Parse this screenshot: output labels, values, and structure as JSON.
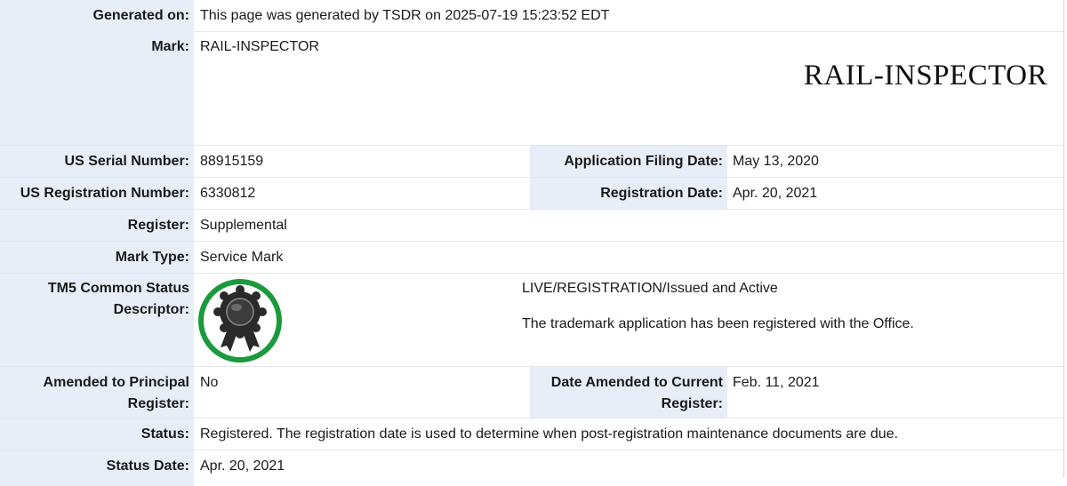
{
  "generated": {
    "label": "Generated on:",
    "value": "This page was generated by TSDR on 2025-07-19 15:23:52 EDT"
  },
  "mark": {
    "label": "Mark:",
    "value": "RAIL-INSPECTOR",
    "image_text": "RAIL-INSPECTOR"
  },
  "serial": {
    "label": "US Serial Number:",
    "value": "88915159"
  },
  "filing_date": {
    "label": "Application Filing Date:",
    "value": "May 13, 2020"
  },
  "registration_number": {
    "label": "US Registration Number:",
    "value": "6330812"
  },
  "registration_date": {
    "label": "Registration Date:",
    "value": "Apr. 20, 2021"
  },
  "register": {
    "label": "Register:",
    "value": "Supplemental"
  },
  "mark_type": {
    "label": "Mark Type:",
    "value": "Service Mark"
  },
  "tm5": {
    "label_line1": "TM5 Common Status",
    "label_line2": "Descriptor:",
    "status_line": "LIVE/REGISTRATION/Issued and Active",
    "description": "The trademark application has been registered with the Office.",
    "icon": "ribbon-badge-icon",
    "icon_ring_color": "#1a9a3c"
  },
  "amended_principal": {
    "label_line1": "Amended to Principal",
    "label_line2": "Register:",
    "value": "No"
  },
  "date_amended": {
    "label_line1": "Date Amended to Current",
    "label_line2": "Register:",
    "value": "Feb. 11, 2021"
  },
  "status": {
    "label": "Status:",
    "value": "Registered. The registration date is used to determine when post-registration maintenance documents are due."
  },
  "status_date": {
    "label": "Status Date:",
    "value": "Apr. 20, 2021"
  },
  "colors": {
    "label_bg": "#e7eef8",
    "border": "#e3e6ea"
  }
}
